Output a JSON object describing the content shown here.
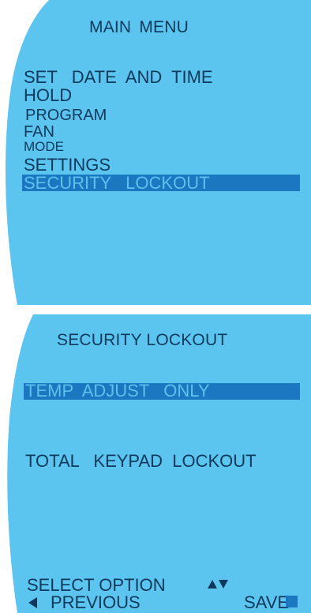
{
  "colors": {
    "screen_bg": "#5bc4ef",
    "text": "#0d3a5c",
    "highlight_bg": "#1a77c0",
    "highlight_text": "#5cc2ec"
  },
  "main_menu": {
    "title": "MAIN  MENU",
    "items": [
      {
        "label": "SET   DATE  AND  TIME"
      },
      {
        "label": "HOLD"
      },
      {
        "label": "PROGRAM"
      },
      {
        "label": "FAN"
      },
      {
        "label": "MODE"
      },
      {
        "label": "SETTINGS"
      },
      {
        "label": "SECURITY   LOCKOUT",
        "selected": true
      }
    ]
  },
  "security_lockout": {
    "title": "SECURITY LOCKOUT",
    "options": [
      {
        "label": "TEMP  ADJUST   ONLY",
        "selected": true
      },
      {
        "label": "TOTAL   KEYPAD  LOCKOUT"
      }
    ],
    "footer": {
      "select_option": "SELECT OPTION",
      "select_icon": "up-down-arrows-icon",
      "previous": "PREVIOUS",
      "previous_icon": "left-arrow-icon",
      "save": "SAVE",
      "save_icon": "square-icon"
    }
  }
}
